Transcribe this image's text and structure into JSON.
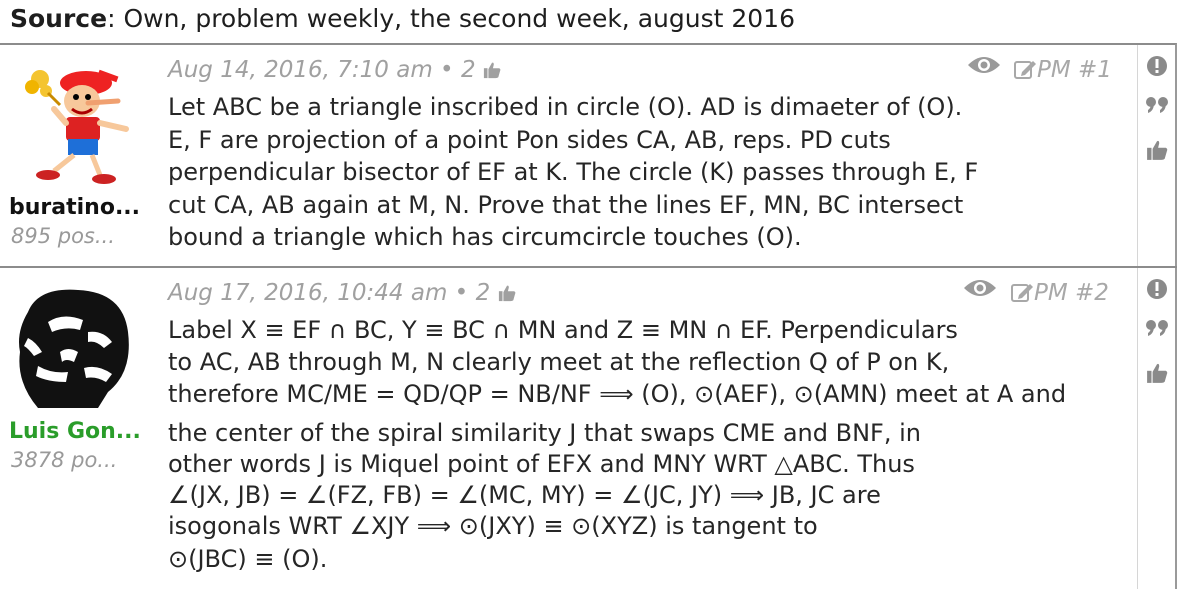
{
  "source": {
    "label": "Source",
    "text": ": Own, problem weekly, the second week, august 2016"
  },
  "posts": [
    {
      "username": "buratino...",
      "username_color": "#111111",
      "postcount": "895 pos...",
      "date": "Aug 14, 2016, 7:10 am",
      "likes": "2",
      "pm": "PM",
      "number": "#1",
      "lines": [
        "Let ABC be a triangle inscribed in circle (O). AD is dimaeter of (O).",
        "E, F are projection of a point Pon sides CA, AB, reps. PD cuts",
        "perpendicular bisector of EF at K. The circle (K) passes through E, F",
        "cut CA, AB again at M, N. Prove that the lines EF, MN, BC intersect",
        "bound a triangle which has circumcircle touches (O)."
      ]
    },
    {
      "username": "Luis Gon...",
      "username_color": "#2a9d2a",
      "postcount": "3878 po...",
      "date": "Aug 17, 2016, 10:44 am",
      "likes": "2",
      "pm": "PM",
      "number": "#2",
      "lines": [
        "Label X ≡ EF ∩ BC, Y ≡ BC ∩ MN and Z ≡ MN ∩ EF. Perpendiculars",
        "to AC, AB through M, N clearly meet at the reflection Q of P on K,",
        "therefore MC/ME = QD/QP = NB/NF ⟹ (O), ⊙(AEF), ⊙(AMN) meet at A and",
        "the center of the spiral similarity J that swaps CME and BNF, in",
        "other words J is Miquel point of EFX and MNY WRT △ABC. Thus",
        "∠(JX, JB) = ∠(FZ, FB) = ∠(MC, MY) = ∠(JC, JY) ⟹ JB, JC are",
        "isogonals WRT ∠XJY ⟹ ⊙(JXY) ≡ ⊙(XYZ) is tangent to",
        "⊙(JBC) ≡ (O)."
      ]
    }
  ],
  "icons": [
    "eye-icon",
    "edit-icon",
    "report-icon",
    "quote-icon",
    "thumbs-up-icon"
  ]
}
